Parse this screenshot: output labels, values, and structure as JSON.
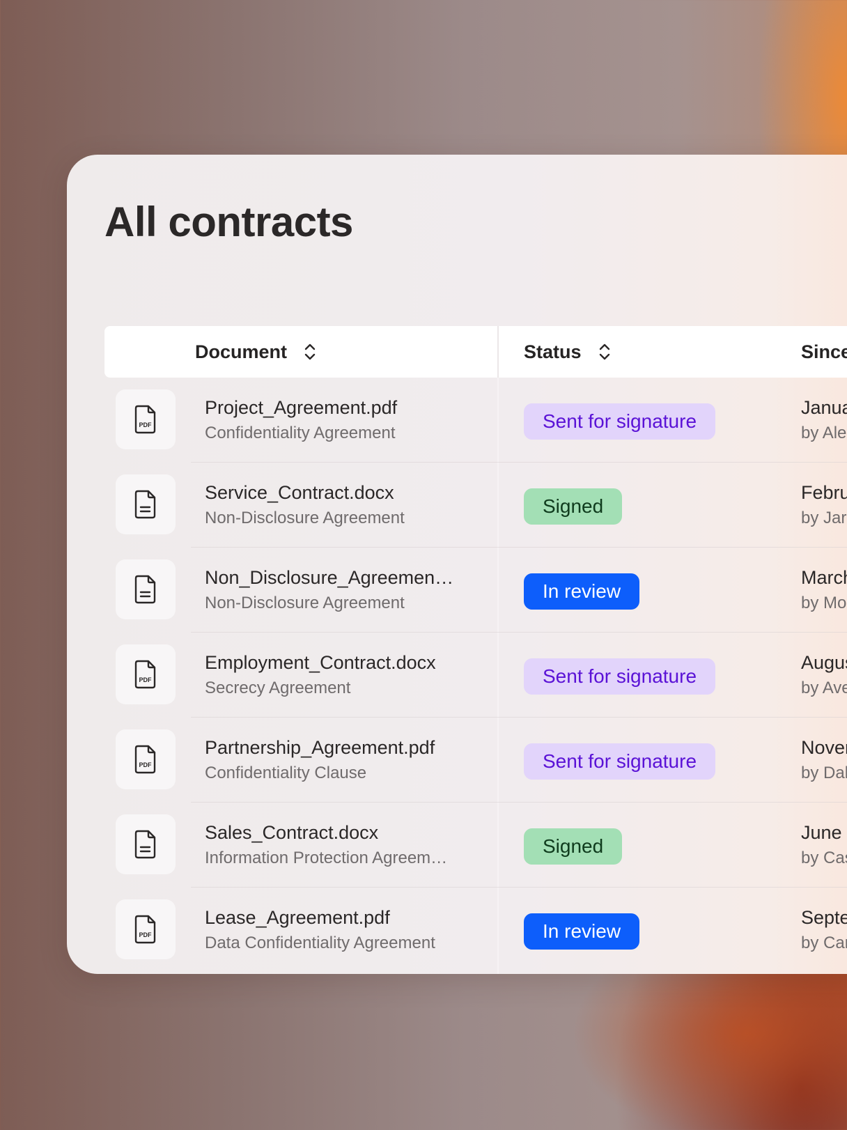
{
  "page": {
    "title": "All contracts"
  },
  "table": {
    "columns": {
      "document": "Document",
      "status": "Status",
      "since": "Since"
    },
    "rows": [
      {
        "file_icon": "pdf-file-icon",
        "name": "Project_Agreement.pdf",
        "type": "Confidentiality Agreement",
        "status": "Sent for signature",
        "status_kind": "sent",
        "since_date": "Janua",
        "since_by": "by Ale"
      },
      {
        "file_icon": "document-file-icon",
        "name": "Service_Contract.docx",
        "type": "Non-Disclosure Agreement",
        "status": "Signed",
        "status_kind": "signed",
        "since_date": "Febru",
        "since_by": "by Jar"
      },
      {
        "file_icon": "document-file-icon",
        "name": "Non_Disclosure_Agreemen…",
        "type": "Non-Disclosure Agreement",
        "status": "In review",
        "status_kind": "review",
        "since_date": "March",
        "since_by": "by Mo"
      },
      {
        "file_icon": "pdf-file-icon",
        "name": "Employment_Contract.docx",
        "type": "Secrecy Agreement",
        "status": "Sent for signature",
        "status_kind": "sent",
        "since_date": "Augus",
        "since_by": "by Ave"
      },
      {
        "file_icon": "pdf-file-icon",
        "name": "Partnership_Agreement.pdf",
        "type": "Confidentiality Clause",
        "status": "Sent for signature",
        "status_kind": "sent",
        "since_date": "Nover",
        "since_by": "by Dal"
      },
      {
        "file_icon": "document-file-icon",
        "name": "Sales_Contract.docx",
        "type": "Information Protection Agreem…",
        "status": "Signed",
        "status_kind": "signed",
        "since_date": "June",
        "since_by": "by Cas"
      },
      {
        "file_icon": "pdf-file-icon",
        "name": "Lease_Agreement.pdf",
        "type": "Data Confidentiality Agreement",
        "status": "In review",
        "status_kind": "review",
        "since_date": "Septe",
        "since_by": "by Car"
      }
    ]
  },
  "colors": {
    "sent_bg": "#e2d4fb",
    "sent_text": "#5a12d6",
    "signed_bg": "#a3dfb5",
    "signed_text": "#0f3b1d",
    "review_bg": "#0d5efb",
    "review_text": "#ffffff"
  }
}
